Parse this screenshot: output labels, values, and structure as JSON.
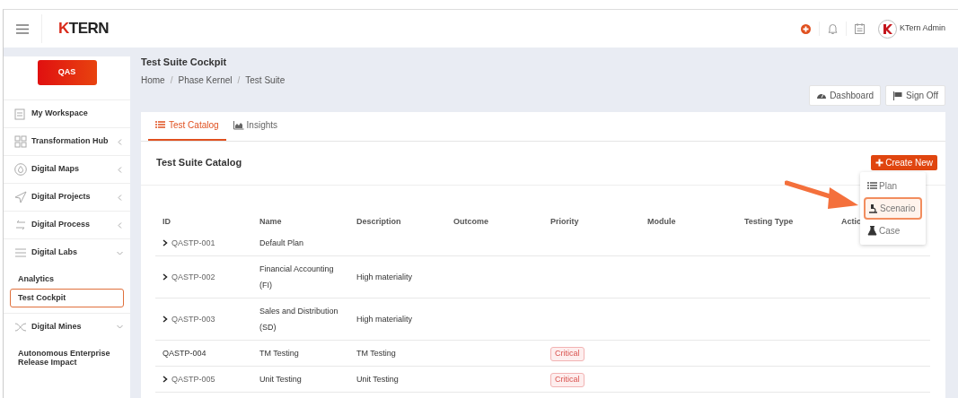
{
  "header": {
    "logo": "KTERN",
    "user_name": "KTern Admin"
  },
  "sidebar": {
    "environment": "QAS",
    "items": [
      {
        "label": "My Workspace"
      },
      {
        "label": "Transformation Hub",
        "expanded": false
      },
      {
        "label": "Digital Maps",
        "expanded": false
      },
      {
        "label": "Digital Projects",
        "expanded": false
      },
      {
        "label": "Digital Process",
        "expanded": false
      },
      {
        "label": "Digital Labs",
        "expanded": true,
        "children": [
          {
            "label": "Analytics",
            "selected": false
          },
          {
            "label": "Test Cockpit",
            "selected": true
          }
        ]
      },
      {
        "label": "Digital Mines",
        "expanded": true,
        "children": [
          {
            "label": "Autonomous Enterprise Release Impact",
            "selected": false
          }
        ]
      }
    ]
  },
  "page": {
    "title": "Test Suite Cockpit",
    "breadcrumbs": [
      {
        "kind": "link",
        "text": "Home"
      },
      {
        "kind": "separator",
        "text": "/"
      },
      {
        "kind": "link",
        "text": "Phase Kernel"
      },
      {
        "kind": "separator",
        "text": "/"
      },
      {
        "kind": "current",
        "text": "Test Suite"
      }
    ],
    "buttons": [
      "Dashboard",
      "Sign Off"
    ]
  },
  "tabs": [
    {
      "label": "Test Catalog",
      "selected": true
    },
    {
      "label": "Insights",
      "selected": false
    }
  ],
  "catalog": {
    "title": "Test Suite Catalog",
    "create_button": "Create New",
    "menu": [
      {
        "label": "Plan",
        "highlighted": false
      },
      {
        "label": "Scenario",
        "highlighted": true
      },
      {
        "label": "Case",
        "highlighted": false
      }
    ],
    "table": {
      "columns": [
        "ID",
        "Name",
        "Description",
        "Outcome",
        "Priority",
        "Module",
        "Testing Type",
        "Actio"
      ],
      "rows": [
        {
          "id": "QASTP-001",
          "name": "Default Plan",
          "expandable": true
        },
        {
          "id": "QASTP-002",
          "name": "Financial Accounting (FI)",
          "description": "High materiality",
          "expandable": true
        },
        {
          "id": "QASTP-003",
          "name": "Sales and Distribution (SD)",
          "description": "High materiality",
          "expandable": true
        },
        {
          "id": "QASTP-004",
          "name": "TM Testing",
          "description": "TM Testing",
          "priority": "Critical",
          "expandable": false
        },
        {
          "id": "QASTP-005",
          "name": "Unit Testing",
          "description": "Unit Testing",
          "priority": "Critical",
          "expandable": true
        }
      ]
    }
  }
}
